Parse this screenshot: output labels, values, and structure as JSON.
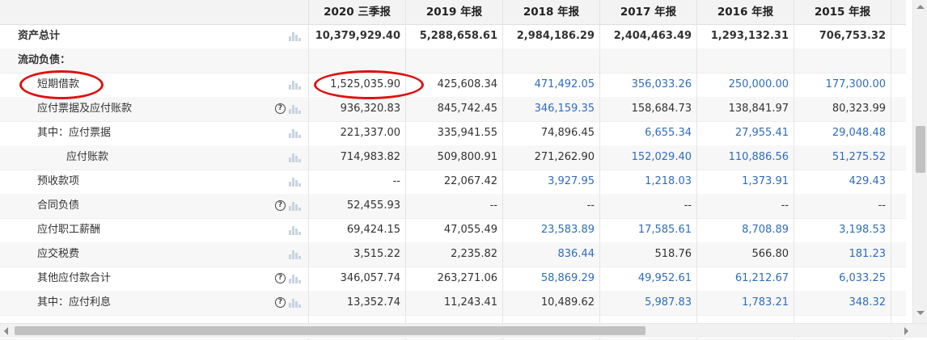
{
  "columns": [
    "2020 三季报",
    "2019 年报",
    "2018 年报",
    "2017 年报",
    "2016 年报",
    "2015 年报"
  ],
  "link_color": "#2f6dbd",
  "highlight_color": "#e01010",
  "rows": [
    {
      "label": "资产总计",
      "indent": 0,
      "bold": true,
      "help": false,
      "chart": true,
      "values": [
        "10,379,929.40",
        "5,288,658.61",
        "2,984,186.29",
        "2,404,463.49",
        "1,293,132.31",
        "706,753.32"
      ],
      "links": [
        false,
        false,
        false,
        false,
        false,
        false
      ]
    },
    {
      "label": "流动负债：",
      "indent": 0,
      "bold": true,
      "help": false,
      "chart": false,
      "values": [
        "",
        "",
        "",
        "",
        "",
        ""
      ],
      "links": [
        false,
        false,
        false,
        false,
        false,
        false
      ]
    },
    {
      "label": "短期借款",
      "indent": 1,
      "bold": false,
      "help": false,
      "chart": true,
      "values": [
        "1,525,035.90",
        "425,608.34",
        "471,492.05",
        "356,033.26",
        "250,000.00",
        "177,300.00"
      ],
      "links": [
        false,
        false,
        true,
        true,
        true,
        true
      ]
    },
    {
      "label": "应付票据及应付账款",
      "indent": 1,
      "bold": false,
      "help": true,
      "chart": true,
      "values": [
        "936,320.83",
        "845,742.45",
        "346,159.35",
        "158,684.73",
        "138,841.97",
        "80,323.99"
      ],
      "links": [
        false,
        false,
        true,
        false,
        false,
        false
      ]
    },
    {
      "label": "其中：应付票据",
      "indent": 1,
      "bold": false,
      "help": false,
      "chart": true,
      "values": [
        "221,337.00",
        "335,941.55",
        "74,896.45",
        "6,655.34",
        "27,955.41",
        "29,048.48"
      ],
      "links": [
        false,
        false,
        false,
        true,
        true,
        true
      ]
    },
    {
      "label": "应付账款",
      "indent": 2,
      "bold": false,
      "help": false,
      "chart": true,
      "values": [
        "714,983.82",
        "509,800.91",
        "271,262.90",
        "152,029.40",
        "110,886.56",
        "51,275.52"
      ],
      "links": [
        false,
        false,
        false,
        true,
        true,
        true
      ]
    },
    {
      "label": "预收款项",
      "indent": 1,
      "bold": false,
      "help": false,
      "chart": true,
      "values": [
        "--",
        "22,067.42",
        "3,927.95",
        "1,218.03",
        "1,373.91",
        "429.43"
      ],
      "links": [
        false,
        false,
        true,
        true,
        true,
        true
      ]
    },
    {
      "label": "合同负债",
      "indent": 1,
      "bold": false,
      "help": true,
      "chart": true,
      "values": [
        "52,455.93",
        "--",
        "--",
        "--",
        "--",
        "--"
      ],
      "links": [
        false,
        false,
        false,
        false,
        false,
        false
      ]
    },
    {
      "label": "应付职工薪酬",
      "indent": 1,
      "bold": false,
      "help": false,
      "chart": true,
      "values": [
        "69,424.15",
        "47,055.49",
        "23,583.89",
        "17,585.61",
        "8,708.89",
        "3,198.53"
      ],
      "links": [
        false,
        false,
        true,
        true,
        true,
        true
      ]
    },
    {
      "label": "应交税费",
      "indent": 1,
      "bold": false,
      "help": false,
      "chart": true,
      "values": [
        "3,515.22",
        "2,235.82",
        "836.44",
        "518.76",
        "566.80",
        "181.23"
      ],
      "links": [
        false,
        false,
        true,
        false,
        false,
        true
      ]
    },
    {
      "label": "其他应付款合计",
      "indent": 1,
      "bold": false,
      "help": true,
      "chart": true,
      "values": [
        "346,057.74",
        "263,271.06",
        "58,869.29",
        "49,952.61",
        "61,212.67",
        "6,033.25"
      ],
      "links": [
        false,
        false,
        true,
        true,
        true,
        true
      ]
    },
    {
      "label": "其中：应付利息",
      "indent": 1,
      "bold": false,
      "help": true,
      "chart": true,
      "values": [
        "13,352.74",
        "11,243.41",
        "10,489.62",
        "5,987.83",
        "1,783.21",
        "348.32"
      ],
      "links": [
        false,
        false,
        false,
        true,
        true,
        true
      ]
    },
    {
      "label": "",
      "indent": 1,
      "bold": false,
      "help": false,
      "chart": true,
      "values": [
        "",
        "",
        "",
        "",
        "",
        ""
      ],
      "links": [
        false,
        false,
        false,
        false,
        false,
        false
      ]
    }
  ]
}
